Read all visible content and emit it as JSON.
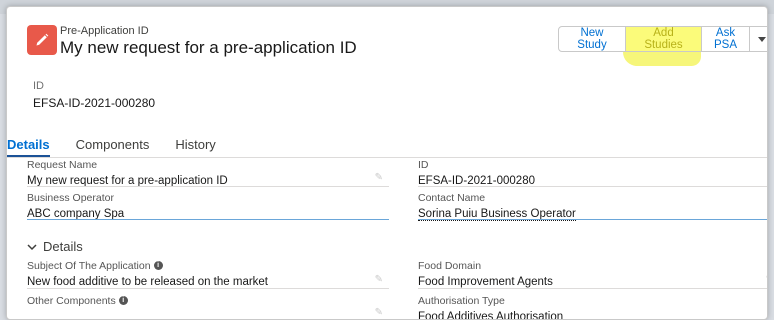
{
  "header": {
    "object_type": "Pre-Application ID",
    "title": "My new request for a pre-application ID",
    "icon": "pencil-icon",
    "icon_color": "#e8594a",
    "buttons": {
      "new_study": "New Study",
      "add_studies": "Add Studies",
      "ask_psa": "Ask PSA"
    },
    "highlight_color": "#fbfb7a"
  },
  "highlights": {
    "id_label": "ID",
    "id_value": "EFSA-ID-2021-000280"
  },
  "tabs": [
    {
      "label": "Details"
    },
    {
      "label": "Components"
    },
    {
      "label": "History"
    }
  ],
  "fields": {
    "request_name": {
      "label": "Request Name",
      "value": "My new request for a pre-application ID"
    },
    "id": {
      "label": "ID",
      "value": "EFSA-ID-2021-000280"
    },
    "business_operator": {
      "label": "Business Operator",
      "value": "ABC company Spa"
    },
    "contact_name": {
      "label": "Contact Name",
      "value": "Sorina Puiu Business Operator"
    },
    "subject": {
      "label": "Subject Of The Application",
      "value": "New food additive to be released on the market"
    },
    "food_domain": {
      "label": "Food Domain",
      "value": "Food Improvement Agents"
    },
    "other_components": {
      "label": "Other Components",
      "value": ""
    },
    "authorisation_type": {
      "label": "Authorisation Type",
      "value": "Food Additives Authorisation"
    }
  },
  "section": {
    "label": "Details"
  }
}
